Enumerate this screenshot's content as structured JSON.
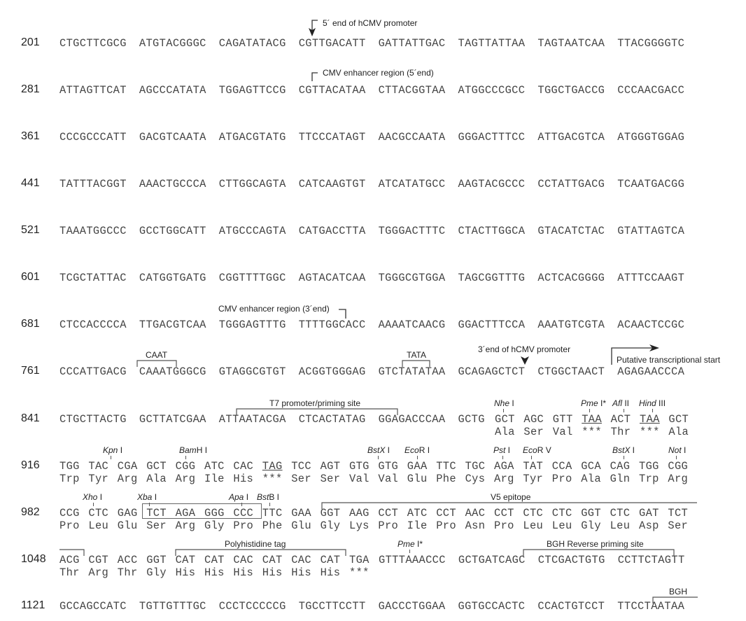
{
  "figure": {
    "rows": [
      {
        "number": "201",
        "blocks": [
          "CTGCTTCGCG",
          "ATGTACGGGC",
          "CAGATATACG",
          "CGTTGACATT",
          "GATTATTGAC",
          "TAGTTATTAA",
          "TAGTAATCAA",
          "TTACGGGGTC"
        ]
      },
      {
        "number": "281",
        "blocks": [
          "ATTAGTTCAT",
          "AGCCCATATA",
          "TGGAGTTCCG",
          "CGTTACATAA",
          "CTTACGGTAA",
          "ATGGCCCGCC",
          "TGGCTGACCG",
          "CCCAACGACC"
        ]
      },
      {
        "number": "361",
        "blocks": [
          "CCCGCCCATT",
          "GACGTCAATA",
          "ATGACGTATG",
          "TTCCCATAGT",
          "AACGCCAATA",
          "GGGACTTTCC",
          "ATTGACGTCA",
          "ATGGGTGGAG"
        ]
      },
      {
        "number": "441",
        "blocks": [
          "TATTTACGGT",
          "AAACTGCCCA",
          "CTTGGCAGTA",
          "CATCAAGTGT",
          "ATCATATGCC",
          "AAGTACGCCC",
          "CCTATTGACG",
          "TCAATGACGG"
        ]
      },
      {
        "number": "521",
        "blocks": [
          "TAAATGGCCC",
          "GCCTGGCATT",
          "ATGCCCAGTA",
          "CATGACCTTA",
          "TGGGACTTTC",
          "CTACTTGGCA",
          "GTACATCTAC",
          "GTATTAGTCA"
        ]
      },
      {
        "number": "601",
        "blocks": [
          "TCGCTATTAC",
          "CATGGTGATG",
          "CGGTTTTGGC",
          "AGTACATCAA",
          "TGGGCGTGGA",
          "TAGCGGTTTG",
          "ACTCACGGGG",
          "ATTTCCAAGT"
        ]
      },
      {
        "number": "681",
        "blocks": [
          "CTCCACCCCA",
          "TTGACGTCAA",
          "TGGGAGTTTG",
          "TTTTGGCACC",
          "AAAATCAACG",
          "GGACTTTCCA",
          "AAATGTCGTA",
          "ACAACTCCGC"
        ]
      },
      {
        "number": "761",
        "blocks": [
          "CCCATTGACG",
          "CAAATGGGCG",
          "GTAGGCGTGT",
          "ACGGTGGGAG",
          "GTCTATATAA",
          "GCAGAGCTCT",
          "CTGGCTAACT",
          "AGAGAACCCA"
        ]
      }
    ],
    "row841": {
      "number": "841",
      "blocks": [
        "CTGCTTACTG",
        "GCTTATCGAA",
        "ATTAATACGA",
        "CTCACTATAG",
        "GGAGACCCAA",
        "GCTG"
      ],
      "codons": [
        "GCT",
        "AGC",
        "GTT",
        "TAA",
        "ACT",
        "TAA",
        "GCT"
      ],
      "aminoacids": [
        "Ala",
        "Ser",
        "Val",
        "***",
        "Thr",
        "***",
        "Ala"
      ]
    },
    "row916": {
      "number": "916",
      "codons": [
        "TGG",
        "TAC",
        "CGA",
        "GCT",
        "CGG",
        "ATC",
        "CAC",
        "TAG",
        "TCC",
        "AGT",
        "GTG",
        "GTG",
        "GAA",
        "TTC",
        "TGC",
        "AGA",
        "TAT",
        "CCA",
        "GCA",
        "CAG",
        "TGG",
        "CGG"
      ],
      "aminoacids": [
        "Trp",
        "Tyr",
        "Arg",
        "Ala",
        "Arg",
        "Ile",
        "His",
        "***",
        "Ser",
        "Ser",
        "Val",
        "Val",
        "Glu",
        "Phe",
        "Cys",
        "Arg",
        "Tyr",
        "Pro",
        "Ala",
        "Gln",
        "Trp",
        "Arg"
      ]
    },
    "row982": {
      "number": "982",
      "codons": [
        "CCG",
        "CTC",
        "GAG",
        "TCT",
        "AGA",
        "GGG",
        "CCC",
        "TTC",
        "GAA",
        "GGT",
        "AAG",
        "CCT",
        "ATC",
        "CCT",
        "AAC",
        "CCT",
        "CTC",
        "CTC",
        "GGT",
        "CTC",
        "GAT",
        "TCT"
      ],
      "aminoacids": [
        "Pro",
        "Leu",
        "Glu",
        "Ser",
        "Arg",
        "Gly",
        "Pro",
        "Phe",
        "Glu",
        "Gly",
        "Lys",
        "Pro",
        "Ile",
        "Pro",
        "Asn",
        "Pro",
        "Leu",
        "Leu",
        "Gly",
        "Leu",
        "Asp",
        "Ser"
      ]
    },
    "row1048": {
      "number": "1048",
      "codons": [
        "ACG",
        "CGT",
        "ACC",
        "GGT",
        "CAT",
        "CAT",
        "CAC",
        "CAT",
        "CAC",
        "CAT",
        "TGA"
      ],
      "aminoacids": [
        "Thr",
        "Arg",
        "Thr",
        "Gly",
        "His",
        "His",
        "His",
        "His",
        "His",
        "His",
        "***"
      ],
      "tail_blocks": [
        "GTTTAAACCC",
        "GCTGATCAGC",
        "CTCGACTGTG",
        "CCTTCTAGTT"
      ]
    },
    "row1121": {
      "number": "1121",
      "blocks": [
        "GCCAGCCATC",
        "TGTTGTTTGC",
        "CCCTCCCCCG",
        "TGCCTTCCTT",
        "GACCCTGGAA",
        "GGTGCCACTC",
        "CCACTGTCCT",
        "TTCCTAATAA"
      ]
    },
    "annotations": {
      "hcmv_5": "5´ end of hCMV promoter",
      "cmv_enh_5": "CMV enhancer region (5´end)",
      "cmv_enh_3": "CMV enhancer region (3´end)",
      "caat": "CAAT",
      "tata": "TATA",
      "hcmv_3": "3´end of hCMV promoter",
      "tx_start": "Putative transcriptional start",
      "t7": "T7 promoter/priming site",
      "v5": "V5 epitope",
      "his": "Polyhistidine tag",
      "bgh_rev": "BGH Reverse priming site",
      "bgh": "BGH"
    },
    "sites": {
      "nhe": {
        "it": "Nhe",
        "rest": " I"
      },
      "pme1": {
        "it": "Pme",
        "rest": " I*"
      },
      "afl": {
        "it": "Afl",
        "rest": " II"
      },
      "hind": {
        "it": "Hind",
        "rest": " III"
      },
      "kpn": {
        "it": "Kpn",
        "rest": " I"
      },
      "bam": {
        "it": "Bam",
        "rest": "H I"
      },
      "bstx1": {
        "it": "BstX",
        "rest": " I"
      },
      "eco": {
        "it": "Eco",
        "rest": "R I"
      },
      "pst": {
        "it": "Pst",
        "rest": " I"
      },
      "ecov": {
        "it": "Eco",
        "rest": "R V"
      },
      "bstx2": {
        "it": "BstX",
        "rest": " I"
      },
      "not": {
        "it": "Not",
        "rest": " I"
      },
      "xho": {
        "it": "Xho",
        "rest": " I"
      },
      "xba": {
        "it": "Xba",
        "rest": " I"
      },
      "apa": {
        "it": "Apa",
        "rest": " I"
      },
      "bstb": {
        "it": "Bst",
        "rest": "B I"
      },
      "pme2": {
        "it": "Pme",
        "rest": " I*"
      }
    }
  }
}
